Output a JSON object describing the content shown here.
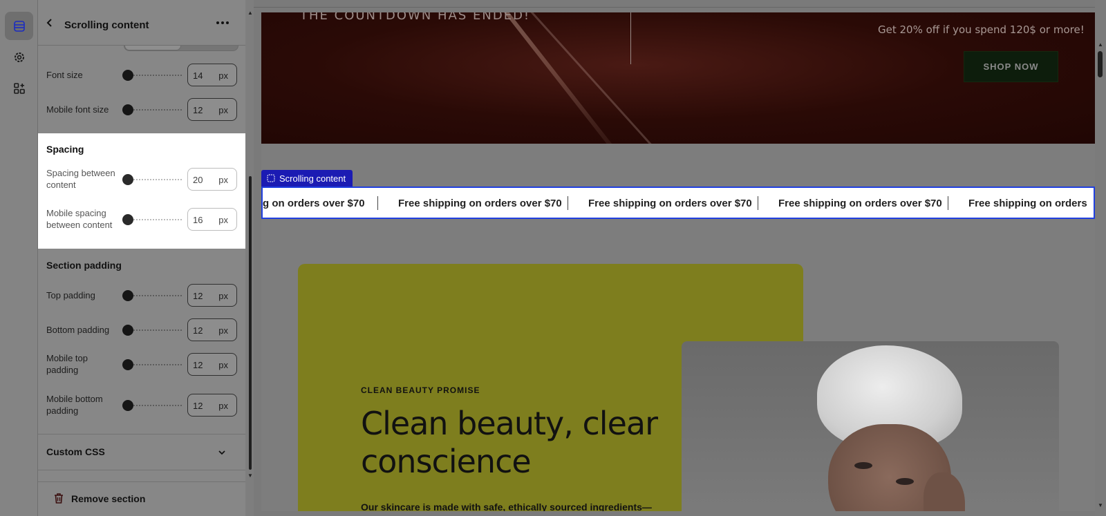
{
  "sidebar": {
    "title": "Scrolling content",
    "typography": {
      "font_size": {
        "label": "Font size",
        "value": "14",
        "unit": "px"
      },
      "mobile_font_size": {
        "label": "Mobile font size",
        "value": "12",
        "unit": "px"
      }
    },
    "spacing": {
      "title": "Spacing",
      "between": {
        "label": "Spacing between content",
        "value": "20",
        "unit": "px"
      },
      "mobile_between": {
        "label": "Mobile spacing between content",
        "value": "16",
        "unit": "px"
      }
    },
    "section_padding": {
      "title": "Section padding",
      "top": {
        "label": "Top padding",
        "value": "12",
        "unit": "px"
      },
      "bottom": {
        "label": "Bottom padding",
        "value": "12",
        "unit": "px"
      },
      "mobile_top": {
        "label": "Mobile top padding",
        "value": "12",
        "unit": "px"
      },
      "mobile_bottom": {
        "label": "Mobile bottom padding",
        "value": "12",
        "unit": "px"
      }
    },
    "custom_css": {
      "title": "Custom CSS"
    },
    "remove_label": "Remove section"
  },
  "preview": {
    "hero": {
      "countdown_text": "THE COUNTDOWN HAS ENDED!",
      "offer_text": "Get 20% off if you spend 120$ or more!",
      "button_label": "SHOP NOW"
    },
    "scrolling": {
      "tag_label": "Scrolling content",
      "items": [
        "g on orders over $70",
        "Free shipping on orders over $70",
        "Free shipping on orders over $70",
        "Free shipping on orders over $70",
        "Free shipping on orders"
      ]
    },
    "promo": {
      "eyebrow": "CLEAN BEAUTY PROMISE",
      "title": "Clean beauty, clear conscience",
      "body": "Our skincare is made with safe, ethically sourced ingredients—"
    }
  },
  "colors": {
    "accent": "#1f3fe0",
    "tag": "#1b1bb3",
    "promo_bg": "#7e7e1e"
  }
}
